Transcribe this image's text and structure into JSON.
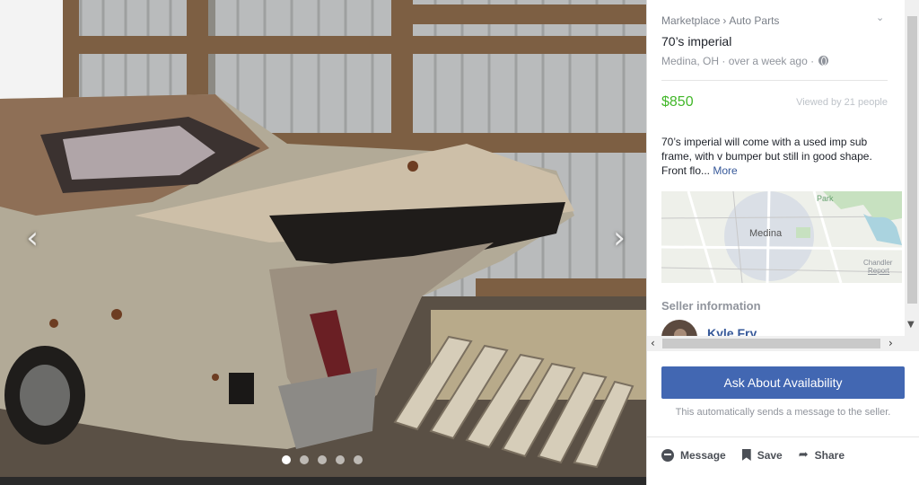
{
  "photo": {
    "prev_icon": "chevron-left-icon",
    "next_icon": "chevron-right-icon",
    "prev_glyph": "‹",
    "next_glyph": "›",
    "image_count": 5,
    "active_index": 0
  },
  "listing": {
    "breadcrumb": [
      "Marketplace",
      "Auto Parts"
    ],
    "breadcrumb_sep": "›",
    "title": "70’s imperial",
    "location": "Medina, OH",
    "posted": "over a week ago",
    "meta_sep": "·",
    "price": "$850",
    "viewed": "Viewed by 21 people",
    "description": "70’s imperial will come with a used imp sub frame, with v bumper but still in good shape. Front flo...",
    "more_label": "More",
    "price_color": "#42b72a"
  },
  "map": {
    "city_label": "Medina",
    "park_label": "Park",
    "attribution": "Chandler",
    "report_label": "Report"
  },
  "seller": {
    "heading": "Seller information",
    "name": "Kyle Fry"
  },
  "actions": {
    "ask_label": "Ask About Availability",
    "auto_note": "This automatically sends a message to the seller.",
    "message_label": "Message",
    "save_label": "Save",
    "share_label": "Share"
  },
  "colors": {
    "button_blue": "#4267b2",
    "link_blue": "#365899"
  }
}
